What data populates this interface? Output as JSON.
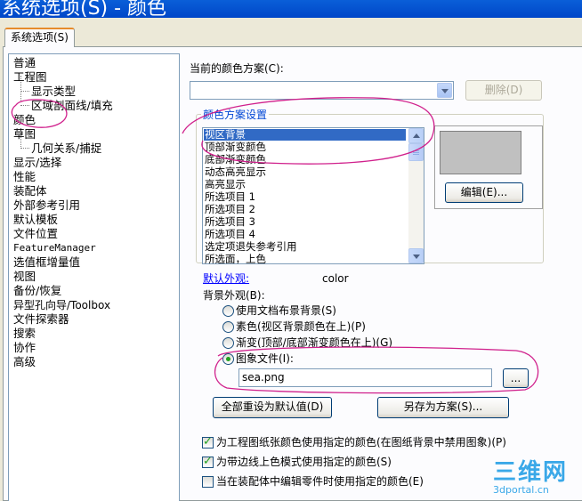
{
  "window": {
    "title": "系统选项(S) - 颜色"
  },
  "tab": {
    "label": "系统选项(S)"
  },
  "tree": {
    "items": [
      "普通",
      "工程图",
      "显示类型",
      "区域剖面线/填充",
      "颜色",
      "草图",
      "几何关系/捕捉",
      "显示/选择",
      "性能",
      "装配体",
      "外部参考引用",
      "默认模板",
      "文件位置",
      "FeatureManager",
      "选值框增量值",
      "视图",
      "备份/恢复",
      "异型孔向导/Toolbox",
      "文件探索器",
      "搜索",
      "协作",
      "高级"
    ]
  },
  "scheme": {
    "label": "当前的颜色方案(C):",
    "value": "",
    "delete_label": "删除(D)"
  },
  "settings": {
    "group_title": "颜色方案设置",
    "items": [
      "视区背景",
      "顶部渐变颜色",
      "底部渐变颜色",
      "动态高亮显示",
      "高亮显示",
      "所选项目 1",
      "所选项目 2",
      "所选项目 3",
      "所选项目 4",
      "选定项退失参考引用",
      "所选面，上色"
    ],
    "edit_label": "编辑(E)..."
  },
  "appearance": {
    "default_link": "默认外观:",
    "default_value": "color",
    "bg_label": "背景外观(B):",
    "options": [
      "使用文档布景背景(S)",
      "素色(视区背景颜色在上)(P)",
      "渐变(顶部/底部渐变颜色在上)(G)",
      "图象文件(I):"
    ],
    "selected_option": 3,
    "image_file": "sea.png",
    "browse_label": "..."
  },
  "actions": {
    "reset_label": "全部重设为默认值(D)",
    "save_label": "另存为方案(S)..."
  },
  "checkboxes": [
    {
      "label": "为工程图纸张颜色使用指定的颜色(在图纸背景中禁用图象)(P)",
      "checked": true
    },
    {
      "label": "为带边线上色模式使用指定的颜色(S)",
      "checked": true
    },
    {
      "label": "当在装配体中编辑零件时使用指定的颜色(E)",
      "checked": false
    }
  ],
  "watermark": {
    "logo": "三维网",
    "site": "3dportal.cn"
  },
  "colors": {
    "selection": "#316ac5",
    "annotation": "#d0208c",
    "link": "#0000ff",
    "swatch": "#c0c0c0"
  }
}
